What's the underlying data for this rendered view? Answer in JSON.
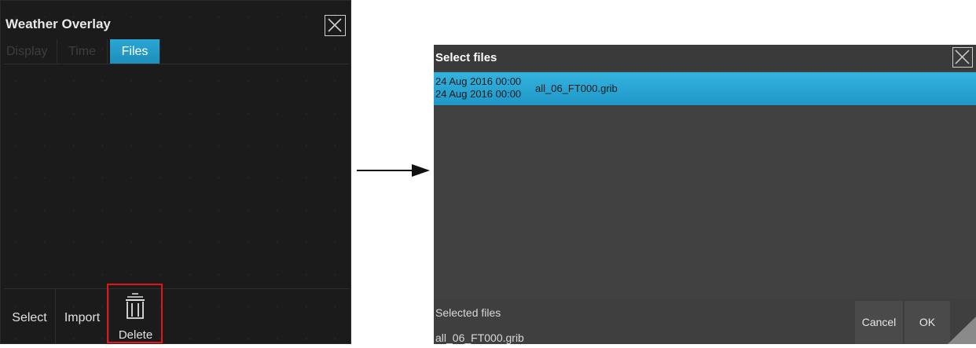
{
  "weather_overlay": {
    "title": "Weather Overlay",
    "tabs": [
      {
        "label": "Display",
        "active": false
      },
      {
        "label": "Time",
        "active": false
      },
      {
        "label": "Files",
        "active": true
      }
    ],
    "toolbar": {
      "select_label": "Select",
      "import_label": "Import",
      "delete_label": "Delete",
      "delete_icon": "trash-icon"
    },
    "close_icon": "close-icon"
  },
  "annotation": {
    "highlight_color": "#e3151a",
    "arrow_icon": "arrow-right-icon"
  },
  "select_files": {
    "title": "Select files",
    "close_icon": "close-icon",
    "files": [
      {
        "date_from": "24 Aug 2016 00:00",
        "date_to": "24 Aug 2016 00:00",
        "name": "all_06_FT000.grib",
        "selected": true
      }
    ],
    "footer": {
      "selected_label": "Selected files",
      "selected_value": "all_06_FT000.grib",
      "cancel_label": "Cancel",
      "ok_label": "OK"
    }
  },
  "colors": {
    "accent": "#1f97c6",
    "panel_dark": "#1b1b1b",
    "dialog_bg": "#414141"
  }
}
